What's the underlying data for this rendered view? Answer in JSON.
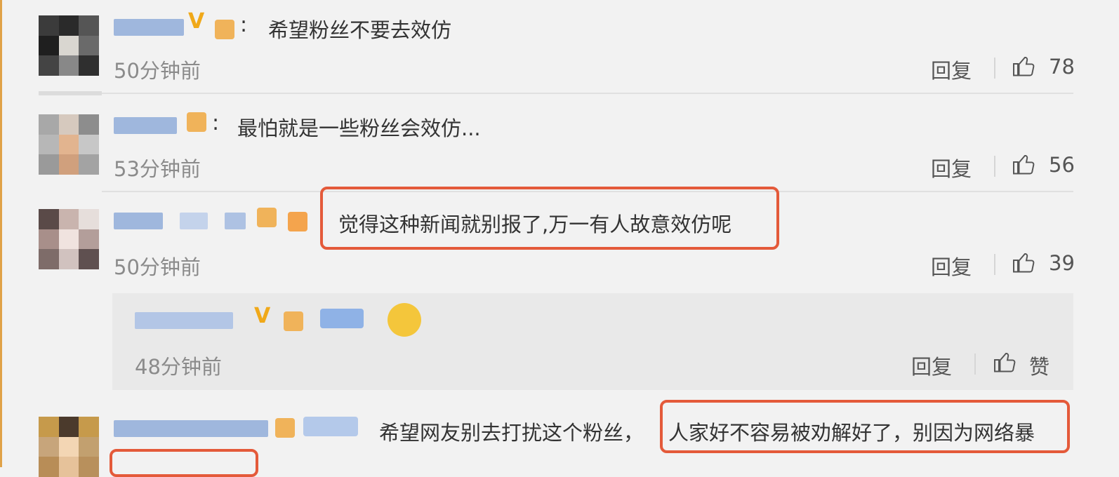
{
  "comments": [
    {
      "text": "希望粉丝不要去效仿",
      "time": "50分钟前",
      "reply_label": "回复",
      "likes": "78"
    },
    {
      "text": "最怕就是一些粉丝会效仿...",
      "time": "53分钟前",
      "reply_label": "回复",
      "likes": "56"
    },
    {
      "text": "觉得这种新闻就别报了,万一有人故意效仿呢",
      "time": "50分钟前",
      "reply_label": "回复",
      "likes": "39"
    }
  ],
  "nested_reply": {
    "time": "48分钟前",
    "reply_label": "回复",
    "like_label": "赞"
  },
  "last_comment": {
    "text_part1": "希望网友别去打扰这个粉丝，",
    "text_part2": "人家好不容易被劝解好了，别因为网络暴"
  },
  "colors": {
    "highlight": "#e45a3a",
    "vbadge": "#f0a91a",
    "background": "#f2f2f2"
  },
  "icons": {
    "like": "thumbs-up-icon",
    "badge": "verified-v-icon"
  }
}
